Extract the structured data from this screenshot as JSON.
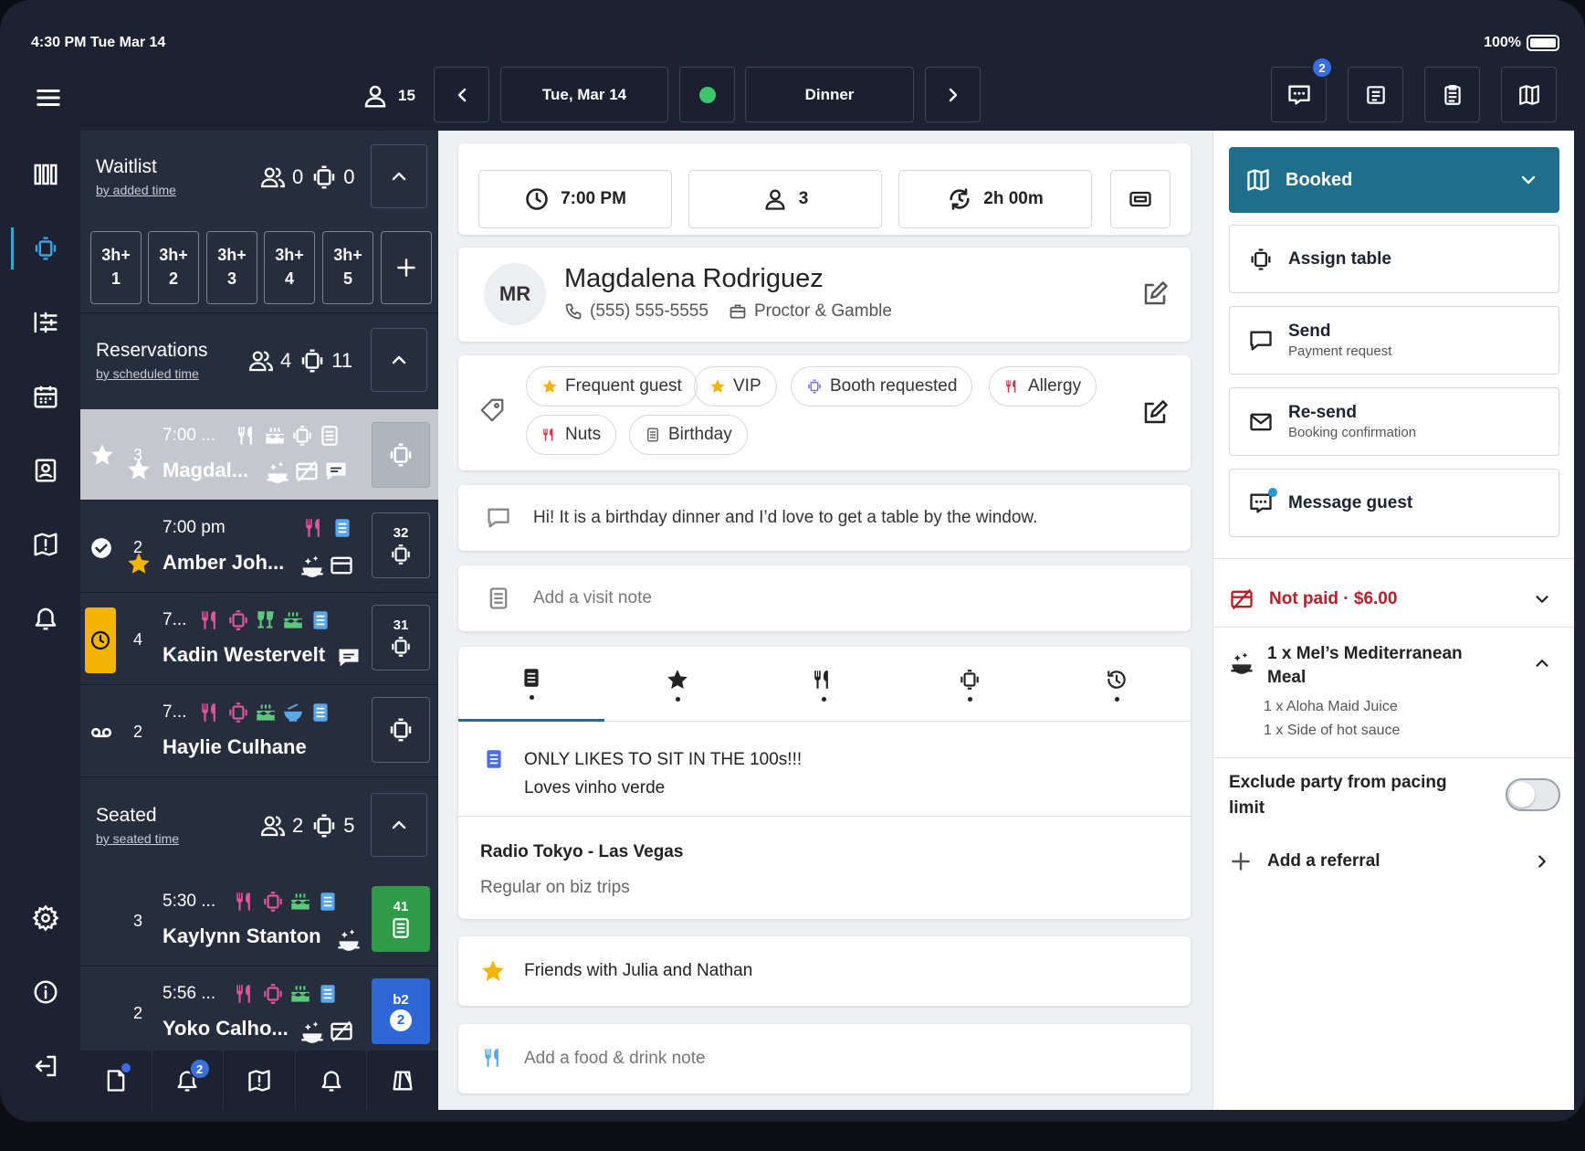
{
  "status": {
    "time": "4:30 PM Tue Mar 14",
    "battery": "100%"
  },
  "topbar": {
    "covers": "15",
    "date": "Tue, Mar 14",
    "shift": "Dinner",
    "messages_badge": "2"
  },
  "waitlist": {
    "title": "Waitlist",
    "sort": "by added time",
    "guests": "0",
    "tables": "0",
    "quotes": [
      {
        "top": "3h+",
        "bottom": "1"
      },
      {
        "top": "3h+",
        "bottom": "2"
      },
      {
        "top": "3h+",
        "bottom": "3"
      },
      {
        "top": "3h+",
        "bottom": "4"
      },
      {
        "top": "3h+",
        "bottom": "5"
      }
    ]
  },
  "reservations": {
    "title": "Reservations",
    "sort": "by scheduled time",
    "guests": "4",
    "tables": "11",
    "rows": [
      {
        "count": "3",
        "time": "7:00 ...",
        "name": "Magdal..."
      },
      {
        "count": "2",
        "time": "7:00 pm",
        "name": "Amber Joh...",
        "table": "32"
      },
      {
        "count": "4",
        "time": "7...",
        "name": "Kadin Westervelt",
        "table": "31"
      },
      {
        "count": "2",
        "time": "7...",
        "name": "Haylie Culhane"
      }
    ]
  },
  "seated": {
    "title": "Seated",
    "sort": "by seated time",
    "guests": "2",
    "tables": "5",
    "rows": [
      {
        "count": "3",
        "time": "5:30 ...",
        "name": "Kaylynn Stanton",
        "table": "41"
      },
      {
        "count": "2",
        "time": "5:56 ...",
        "name": "Yoko Calho...",
        "table": "b2",
        "course": "2"
      }
    ]
  },
  "bottomnav": {
    "alerts_badge": "2"
  },
  "booking": {
    "time": "7:00 PM",
    "party": "3",
    "duration": "2h 00m"
  },
  "guest": {
    "initials": "MR",
    "name": "Magdalena Rodriguez",
    "phone": "(555) 555-5555",
    "company": "Proctor & Gamble"
  },
  "tags": [
    "Frequent guest",
    "VIP",
    "Booth requested",
    "Allergy",
    "Nuts",
    "Birthday"
  ],
  "request_note": "Hi! It is a birthday dinner and I’d love to get a table by the window.",
  "visit_note_placeholder": "Add a visit note",
  "profile_note": {
    "line1": "ONLY LIKES TO SIT IN THE 100s!!!",
    "line2": "Loves vinho verde"
  },
  "company_note": {
    "title": "Radio Tokyo - Las Vegas",
    "body": "Regular on biz trips"
  },
  "star_note": "Friends with Julia and Nathan",
  "food_note_placeholder": "Add a food & drink note",
  "status_menu": {
    "label": "Booked",
    "color": "#1f6e8c"
  },
  "actions": {
    "assign": "Assign table",
    "send": "Send",
    "send_sub": "Payment request",
    "resend": "Re-send",
    "resend_sub": "Booking confirmation",
    "message": "Message guest"
  },
  "payment": {
    "status": "Not paid · $6.00",
    "color": "#b3202a"
  },
  "order": {
    "item": "1 x Mel’s Mediterranean Meal",
    "addons": [
      "1 x Aloha Maid Juice",
      "1 x Side of hot sauce"
    ]
  },
  "pacing": {
    "label": "Exclude party from pacing limit",
    "enabled": false
  },
  "referral": "Add a referral",
  "colors": {
    "pink": "#e0559b",
    "green": "#5cc97a",
    "blue": "#5aa6e8",
    "purple": "#7b6cf0",
    "gold": "#f5b400"
  }
}
